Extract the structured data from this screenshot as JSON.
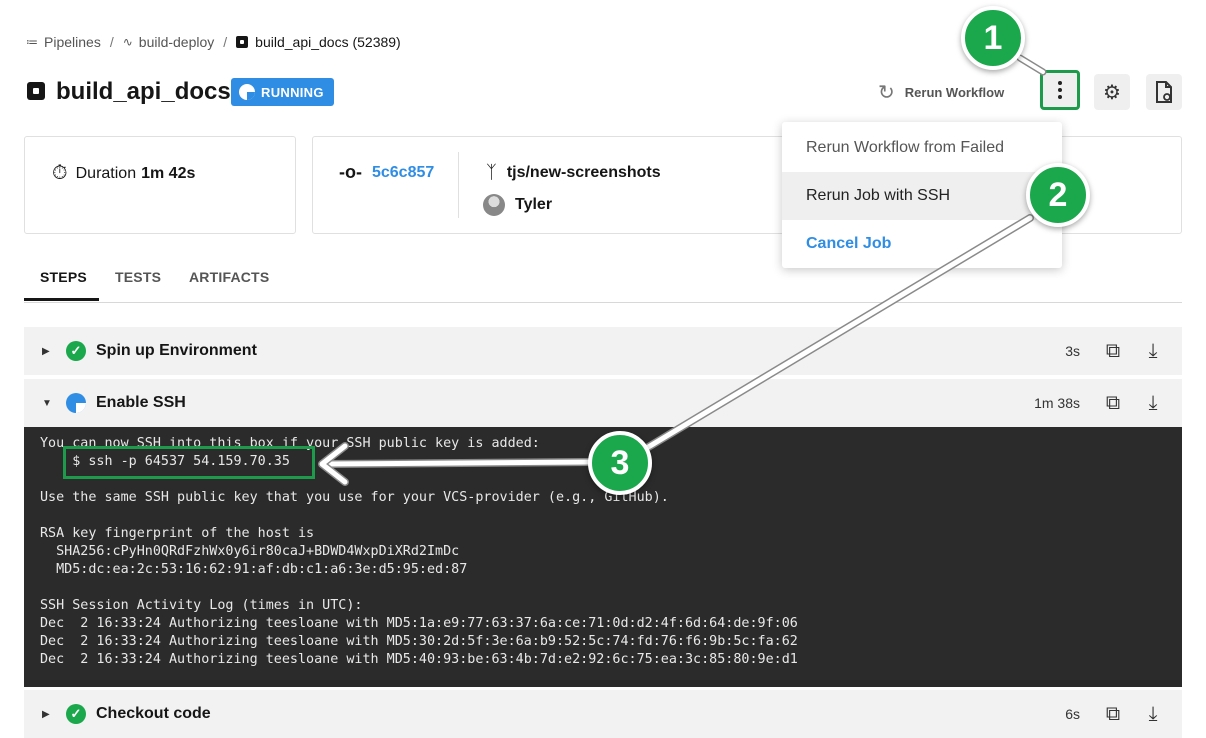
{
  "breadcrumb": {
    "pipelines": "Pipelines",
    "workflow": "build-deploy",
    "job": "build_api_docs (52389)"
  },
  "header": {
    "title": "build_api_docs",
    "status": "RUNNING",
    "rerun_label": "Rerun Workflow"
  },
  "summary": {
    "duration_label": "Duration",
    "duration_value": "1m 42s",
    "commit": "5c6c857",
    "branch": "tjs/new-screenshots",
    "user": "Tyler"
  },
  "menu": {
    "items": [
      "Rerun Workflow from Failed",
      "Rerun Job with SSH",
      "Cancel Job"
    ]
  },
  "tabs": [
    "STEPS",
    "TESTS",
    "ARTIFACTS"
  ],
  "steps": [
    {
      "name": "Spin up Environment",
      "duration": "3s",
      "status": "success"
    },
    {
      "name": "Enable SSH",
      "duration": "1m 38s",
      "status": "running"
    },
    {
      "name": "Checkout code",
      "duration": "6s",
      "status": "success"
    }
  ],
  "terminal": {
    "lines": [
      "You can now SSH into this box if your SSH public key is added:",
      "    $ ssh -p 64537 54.159.70.35",
      "",
      "Use the same SSH public key that you use for your VCS-provider (e.g., GitHub).",
      "",
      "RSA key fingerprint of the host is",
      "  SHA256:cPyHn0QRdFzhWx0y6ir80caJ+BDWD4WxpDiXRd2ImDc",
      "  MD5:dc:ea:2c:53:16:62:91:af:db:c1:a6:3e:d5:95:ed:87",
      "",
      "SSH Session Activity Log (times in UTC):",
      "Dec  2 16:33:24 Authorizing teesloane with MD5:1a:e9:77:63:37:6a:ce:71:0d:d2:4f:6d:64:de:9f:06",
      "Dec  2 16:33:24 Authorizing teesloane with MD5:30:2d:5f:3e:6a:b9:52:5c:74:fd:76:f6:9b:5c:fa:62",
      "Dec  2 16:33:24 Authorizing teesloane with MD5:40:93:be:63:4b:7d:e2:92:6c:75:ea:3c:85:80:9e:d1"
    ]
  },
  "annotations": [
    "1",
    "2",
    "3"
  ],
  "colors": {
    "accent_blue": "#2f8de4",
    "success_green": "#1ba84c",
    "highlight_green": "#1e9b4a",
    "terminal_bg": "#2b2b2b"
  }
}
